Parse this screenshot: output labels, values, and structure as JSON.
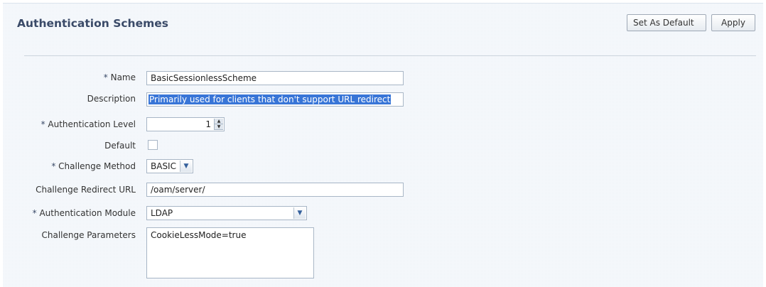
{
  "header": {
    "title": "Authentication Schemes",
    "set_default_label": "Set As Default",
    "apply_label": "Apply"
  },
  "form": {
    "required_marker": "*",
    "name": {
      "label": "Name",
      "value": "BasicSessionlessScheme",
      "required": true
    },
    "description": {
      "label": "Description",
      "value": "Primarily used for clients that don't support URL redirect"
    },
    "auth_level": {
      "label": "Authentication Level",
      "value": "1",
      "required": true
    },
    "default": {
      "label": "Default",
      "checked": false
    },
    "challenge_method": {
      "label": "Challenge Method",
      "value": "BASIC",
      "required": true
    },
    "challenge_redirect_url": {
      "label": "Challenge Redirect URL",
      "value": "/oam/server/"
    },
    "auth_module": {
      "label": "Authentication Module",
      "value": "LDAP",
      "required": true
    },
    "challenge_params": {
      "label": "Challenge Parameters",
      "value": "CookieLessMode=true"
    }
  },
  "colors": {
    "title": "#3a4a68",
    "selection_highlight": "#3875d7",
    "panel_background": "#eef3f9"
  },
  "icons": {
    "dropdown": "chevron-down-icon",
    "spinner_up": "spinner-up-icon",
    "spinner_down": "spinner-down-icon"
  }
}
